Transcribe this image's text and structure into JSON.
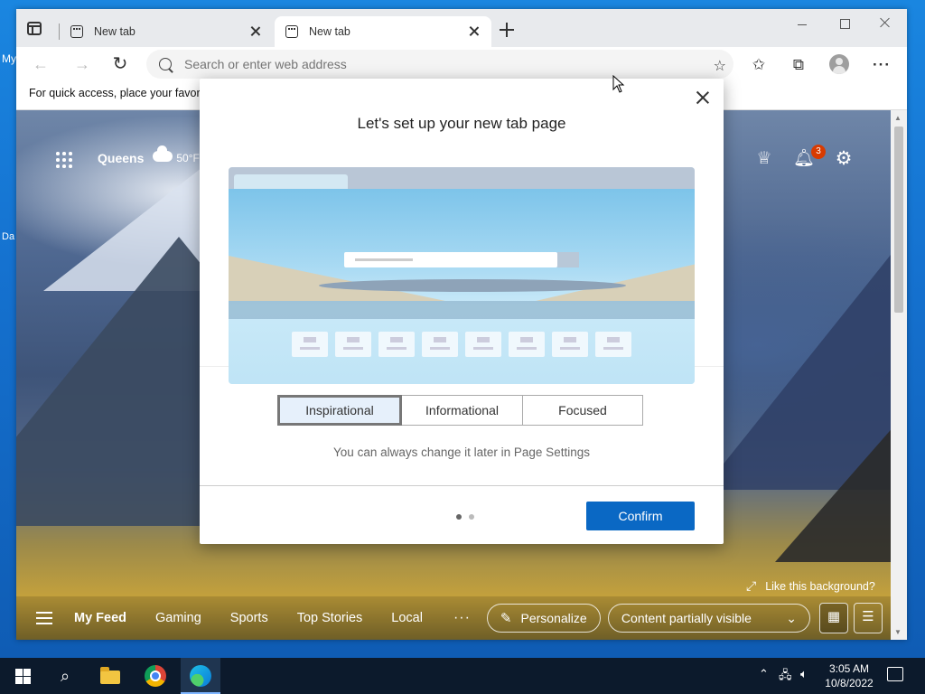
{
  "desktop": {
    "icons": [
      {
        "label": "My"
      },
      {
        "label": "Da"
      }
    ]
  },
  "browser": {
    "tabs": [
      {
        "label": "New tab"
      },
      {
        "label": "New tab"
      }
    ],
    "address_placeholder": "Search or enter web address",
    "favorites_bar_text": "For quick access, place your favorit"
  },
  "ntp": {
    "weather": {
      "city": "Queens",
      "temp": "50°F",
      "icon": "cloud-icon"
    },
    "notifications_count": "3",
    "like_background": "Like this background?",
    "feed_tabs": [
      "My Feed",
      "Gaming",
      "Sports",
      "Top Stories",
      "Local"
    ],
    "personalize_label": "Personalize",
    "content_visibility_label": "Content partially visible"
  },
  "modal": {
    "title": "Let's set up your new tab page",
    "options": [
      "Inspirational",
      "Informational",
      "Focused"
    ],
    "selected_option": "Inspirational",
    "hint": "You can always change it later in Page Settings",
    "confirm_label": "Confirm",
    "step_current": 1,
    "step_total": 2
  },
  "taskbar": {
    "time": "3:05 AM",
    "date": "10/8/2022"
  },
  "colors": {
    "accent": "#0a68c4",
    "badge": "#d83b01"
  }
}
